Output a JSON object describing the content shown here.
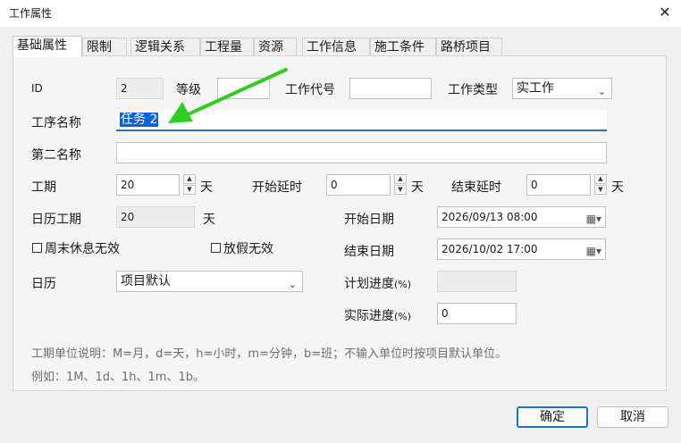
{
  "window": {
    "title": "工作属性",
    "close_glyph": "✕"
  },
  "tabs": [
    {
      "label": "基础属性",
      "active": true
    },
    {
      "label": "限制"
    },
    {
      "label": "逻辑关系"
    },
    {
      "label": "工程量"
    },
    {
      "label": "资源"
    },
    {
      "label": "工作信息"
    },
    {
      "label": "施工条件"
    },
    {
      "label": "路桥项目"
    }
  ],
  "form": {
    "id_label": "ID",
    "id_value": "2",
    "grade_label": "等级",
    "grade_value": "",
    "code_label": "工作代号",
    "code_value": "",
    "type_label": "工作类型",
    "type_value": "实工作",
    "name_label": "工序名称",
    "name_value": "任务 2",
    "second_name_label": "第二名称",
    "second_name_value": "",
    "duration_label": "工期",
    "duration_value": "20",
    "duration_unit": "天",
    "start_delay_label": "开始延时",
    "start_delay_value": "0",
    "start_delay_unit": "天",
    "end_delay_label": "结束延时",
    "end_delay_value": "0",
    "end_delay_unit": "天",
    "calendar_duration_label": "日历工期",
    "calendar_duration_value": "20",
    "calendar_duration_unit": "天",
    "start_date_label": "开始日期",
    "start_date_value": "2026/09/13 08:00",
    "end_date_label": "结束日期",
    "end_date_value": "2026/10/02 17:00",
    "weekend_invalid_label": "周末休息无效",
    "holiday_invalid_label": "放假无效",
    "calendar_label": "日历",
    "calendar_value": "项目默认",
    "planned_progress_label": "计划进度",
    "planned_progress_unit": "(%)",
    "planned_progress_value": "",
    "actual_progress_label": "实际进度",
    "actual_progress_unit": "(%)",
    "actual_progress_value": "0"
  },
  "hints": {
    "line1": "工期单位说明：M=月，d=天，h=小时，m=分钟，b=班；不输入单位时按项目默认单位。",
    "line2": "例如：1M、1d、1h、1m、1b。"
  },
  "buttons": {
    "ok": "确定",
    "cancel": "取消"
  },
  "icons": {
    "dropdown": "⌄",
    "spin_up": "▲",
    "spin_down": "▼",
    "calendar": "▦▾"
  },
  "colors": {
    "accent": "#0a64d6",
    "annotation_arrow": "#33cc22",
    "hint_text": "#6e6e6e"
  }
}
